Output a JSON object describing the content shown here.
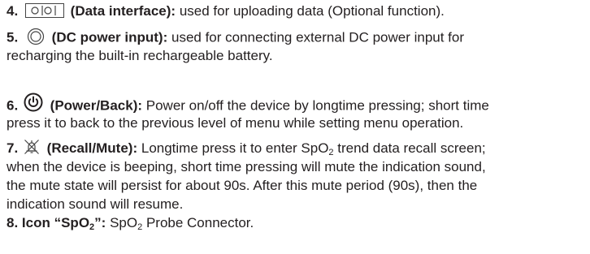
{
  "items": [
    {
      "number": "4.",
      "title": "(Data interface):",
      "icon": "data-interface-icon",
      "text": "used for uploading data (Optional function)."
    },
    {
      "number": "5.",
      "title": "(DC power input):",
      "icon": "dc-power-input-icon",
      "text_line1": "used for connecting external DC power input for",
      "text_line2": "recharging the built-in rechargeable battery."
    },
    {
      "number": "6.",
      "title": "(Power/Back):",
      "icon": "power-icon",
      "text_line1": "Power on/off the device by longtime pressing; short time",
      "text_line2": "press it to back to the previous level of menu while setting menu operation."
    },
    {
      "number": "7.",
      "title": "(Recall/Mute):",
      "icon": "mute-icon",
      "text_line1_a": "Longtime press it to enter SpO",
      "text_line1_sub": "2",
      "text_line1_b": " trend data recall screen;",
      "text_line2": "when the device is beeping, short time pressing will mute the indication sound,",
      "text_line3": "the mute state will persist for about 90s. After this mute period (90s), then the",
      "text_line4": "indication sound will resume."
    },
    {
      "number": "8.",
      "title_a": "Icon “SpO",
      "title_sub": "2",
      "title_b": "”:",
      "text_a": " SpO",
      "text_sub": "2",
      "text_b": " Probe Connector."
    }
  ]
}
